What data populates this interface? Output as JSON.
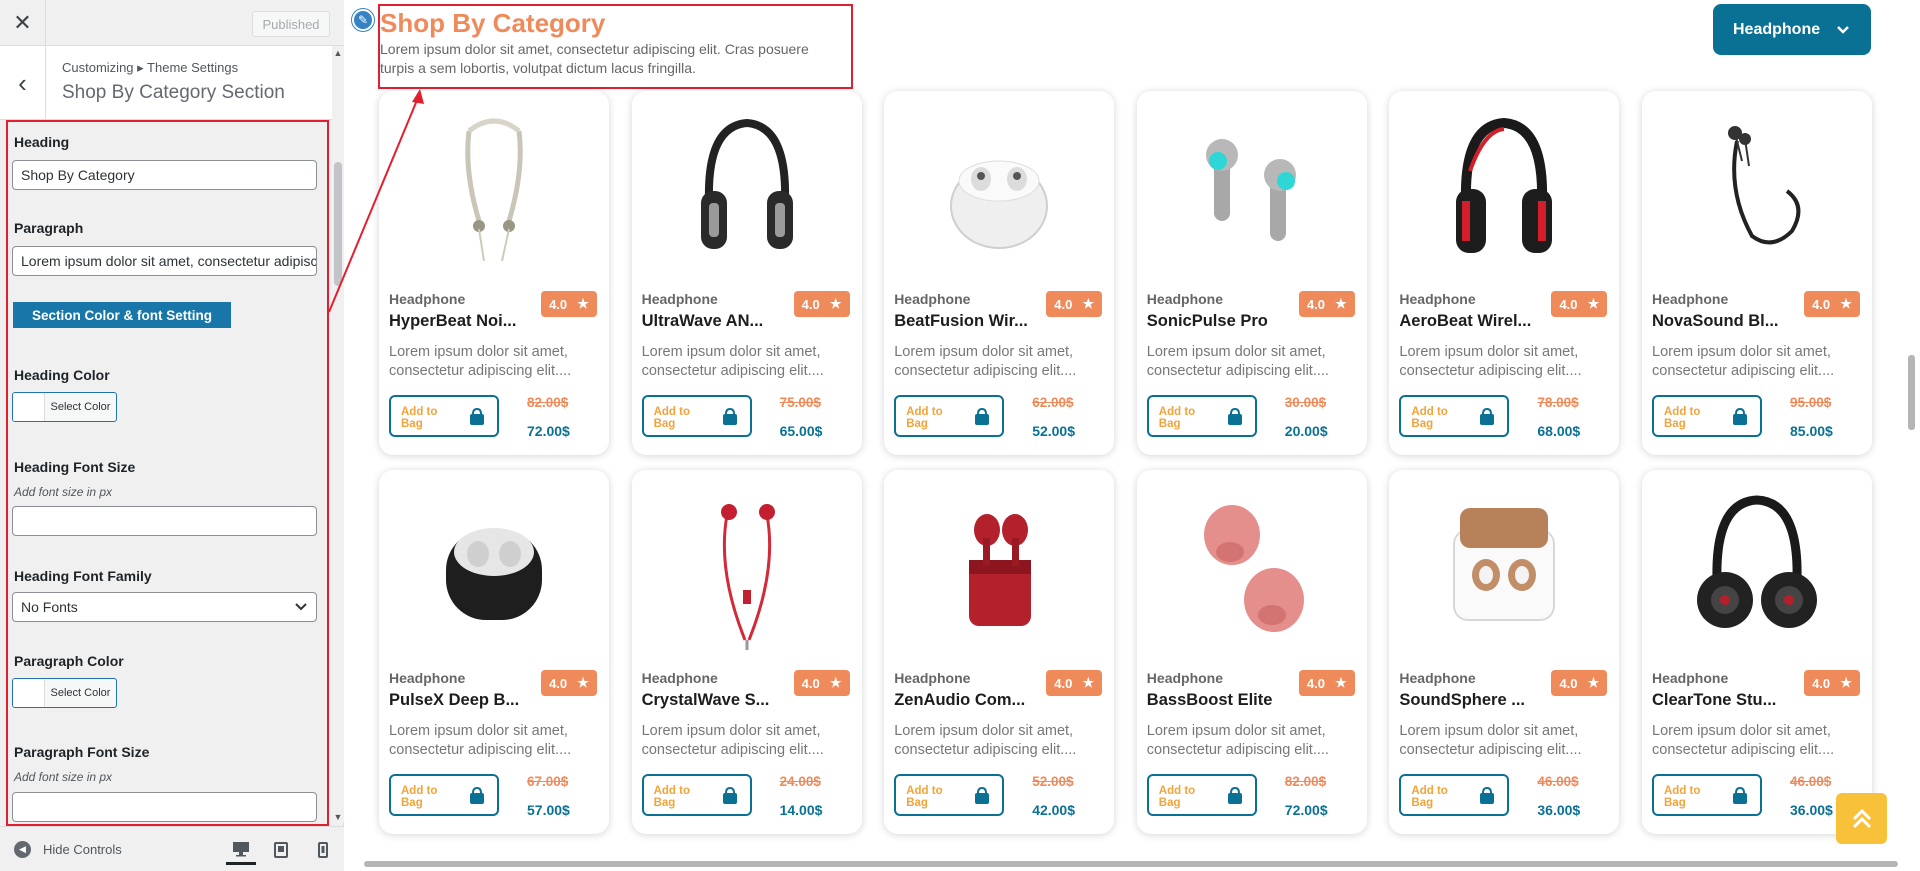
{
  "customizer": {
    "close_icon": "close-icon",
    "published_label": "Published",
    "breadcrumb": "Customizing ▸ Theme Settings",
    "section_title": "Shop By Category Section",
    "fields": {
      "heading_label": "Heading",
      "heading_value": "Shop By Category",
      "paragraph_label": "Paragraph",
      "paragraph_value": "Lorem ipsum dolor sit amet, consectetur adipiscing elit. Cras posuere turpis a sem lobortis, volutpat dictum lacus fringilla.",
      "section_button": "Section Color & font Setting",
      "heading_color_label": "Heading Color",
      "select_color": "Select Color",
      "heading_font_size_label": "Heading Font Size",
      "font_size_hint": "Add font size in px",
      "heading_font_family_label": "Heading Font Family",
      "heading_font_family_value": "No Fonts",
      "paragraph_color_label": "Paragraph Color",
      "paragraph_font_size_label": "Paragraph Font Size"
    },
    "footer": {
      "hide_controls": "Hide Controls",
      "devices": [
        "desktop",
        "tablet",
        "mobile"
      ]
    }
  },
  "preview": {
    "heading": "Shop By Category",
    "paragraph_line1": "Lorem ipsum dolor sit amet, consectetur adipiscing elit. Cras posuere",
    "paragraph_line2": "turpis a sem lobortis, volutpat dictum lacus fringilla.",
    "dropdown_label": "Headphone",
    "colors": {
      "accent": "#ef8a5b",
      "brand": "#0b7194",
      "highlight": "#e01f2f",
      "scroll_top": "#f7c23a"
    },
    "products": [
      {
        "category": "Headphone",
        "name": "HyperBeat Noi...",
        "rating": "4.0",
        "desc1": "Lorem ipsum dolor sit amet,",
        "desc2": "consectetur adipiscing elit....",
        "cta": "Add to Bag",
        "old_price": "82.00$",
        "price": "72.00$",
        "image": "neckband-earphones"
      },
      {
        "category": "Headphone",
        "name": "UltraWave AN...",
        "rating": "4.0",
        "desc1": "Lorem ipsum dolor sit amet,",
        "desc2": "consectetur adipiscing elit....",
        "cta": "Add to Bag",
        "old_price": "75.00$",
        "price": "65.00$",
        "image": "over-ear-headphones"
      },
      {
        "category": "Headphone",
        "name": "BeatFusion Wir...",
        "rating": "4.0",
        "desc1": "Lorem ipsum dolor sit amet,",
        "desc2": "consectetur adipiscing elit....",
        "cta": "Add to Bag",
        "old_price": "62.00$",
        "price": "52.00$",
        "image": "earbuds-case-white"
      },
      {
        "category": "Headphone",
        "name": "SonicPulse Pro",
        "rating": "4.0",
        "desc1": "Lorem ipsum dolor sit amet,",
        "desc2": "consectetur adipiscing elit....",
        "cta": "Add to Bag",
        "old_price": "30.00$",
        "price": "20.00$",
        "image": "earbuds-gray"
      },
      {
        "category": "Headphone",
        "name": "AeroBeat Wirel...",
        "rating": "4.0",
        "desc1": "Lorem ipsum dolor sit amet,",
        "desc2": "consectetur adipiscing elit....",
        "cta": "Add to Bag",
        "old_price": "78.00$",
        "price": "68.00$",
        "image": "gaming-headphones"
      },
      {
        "category": "Headphone",
        "name": "NovaSound Bl...",
        "rating": "4.0",
        "desc1": "Lorem ipsum dolor sit amet,",
        "desc2": "consectetur adipiscing elit....",
        "cta": "Add to Bag",
        "old_price": "95.00$",
        "price": "85.00$",
        "image": "neckband-black"
      },
      {
        "category": "Headphone",
        "name": "PulseX Deep B...",
        "rating": "4.0",
        "desc1": "Lorem ipsum dolor sit amet,",
        "desc2": "consectetur adipiscing elit....",
        "cta": "Add to Bag",
        "old_price": "67.00$",
        "price": "57.00$",
        "image": "earbuds-case-black"
      },
      {
        "category": "Headphone",
        "name": "CrystalWave S...",
        "rating": "4.0",
        "desc1": "Lorem ipsum dolor sit amet,",
        "desc2": "consectetur adipiscing elit....",
        "cta": "Add to Bag",
        "old_price": "24.00$",
        "price": "14.00$",
        "image": "wired-earphones-red"
      },
      {
        "category": "Headphone",
        "name": "ZenAudio Com...",
        "rating": "4.0",
        "desc1": "Lorem ipsum dolor sit amet,",
        "desc2": "consectetur adipiscing elit....",
        "cta": "Add to Bag",
        "old_price": "52.00$",
        "price": "42.00$",
        "image": "earbuds-case-red"
      },
      {
        "category": "Headphone",
        "name": "BassBoost Elite",
        "rating": "4.0",
        "desc1": "Lorem ipsum dolor sit amet,",
        "desc2": "consectetur adipiscing elit....",
        "cta": "Add to Bag",
        "old_price": "82.00$",
        "price": "72.00$",
        "image": "earbuds-pink"
      },
      {
        "category": "Headphone",
        "name": "SoundSphere ...",
        "rating": "4.0",
        "desc1": "Lorem ipsum dolor sit amet,",
        "desc2": "consectetur adipiscing elit....",
        "cta": "Add to Bag",
        "old_price": "46.00$",
        "price": "36.00$",
        "image": "earbuds-case-bronze"
      },
      {
        "category": "Headphone",
        "name": "ClearTone Stu...",
        "rating": "4.0",
        "desc1": "Lorem ipsum dolor sit amet,",
        "desc2": "consectetur adipiscing elit....",
        "cta": "Add to Bag",
        "old_price": "46.00$",
        "price": "36.00$",
        "image": "studio-headphones"
      }
    ]
  }
}
